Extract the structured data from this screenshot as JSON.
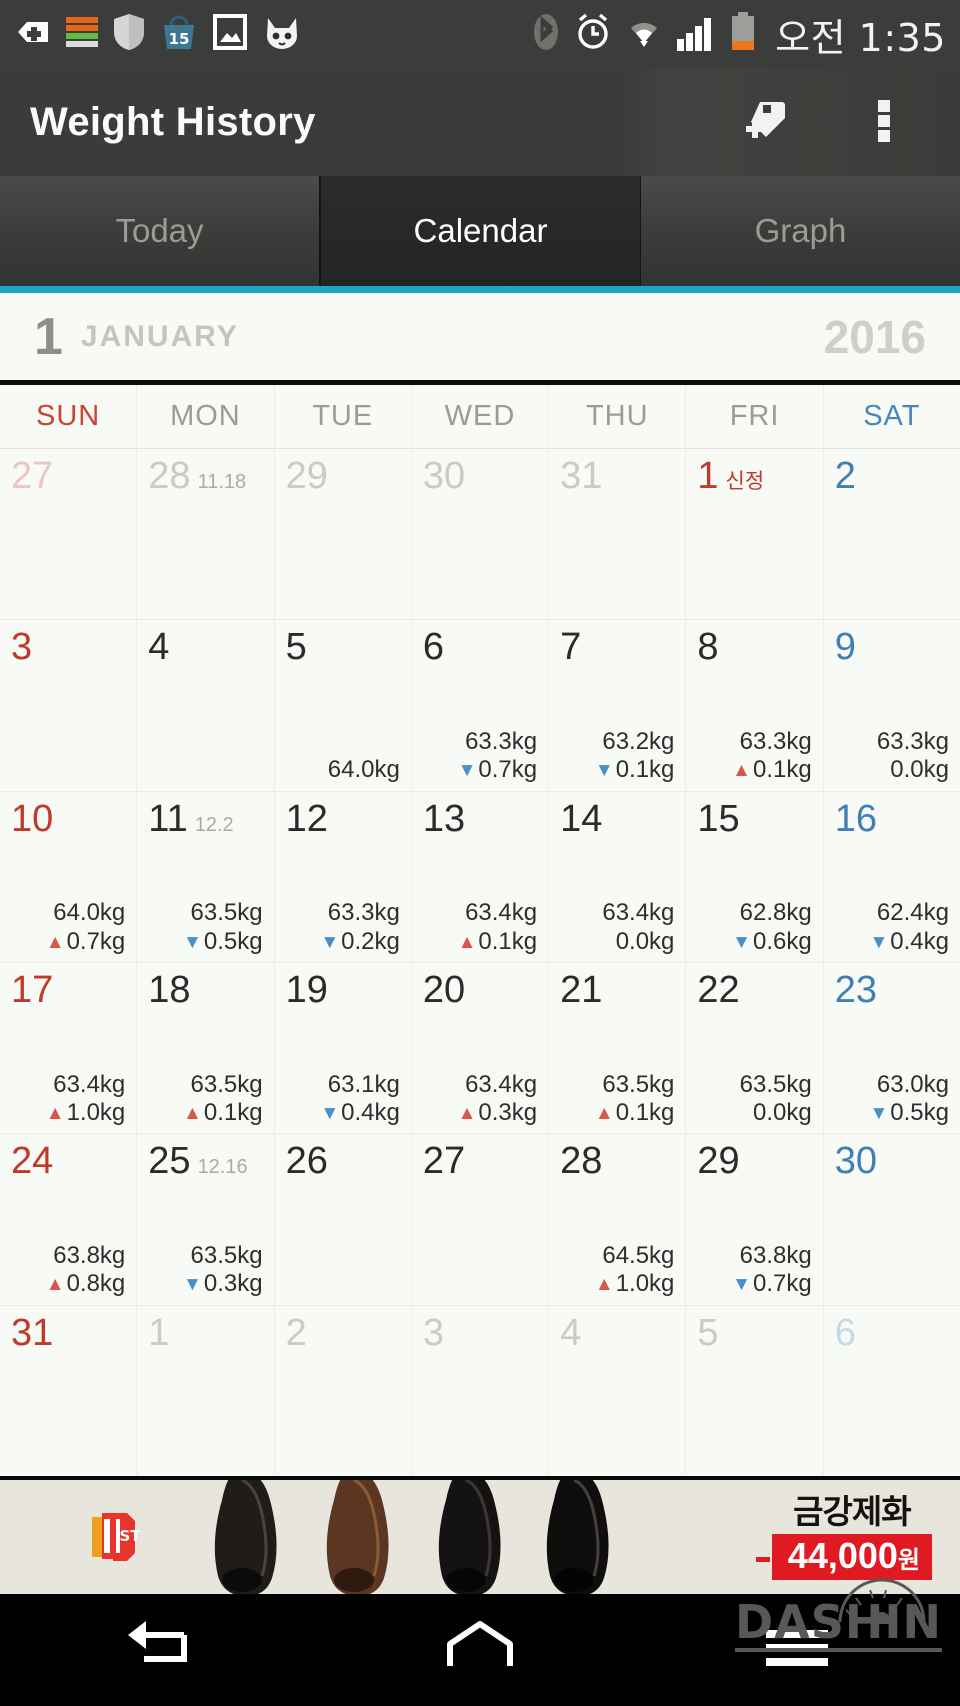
{
  "statusbar": {
    "time": "오전 1:35",
    "left_icons": [
      "medical-plus-icon",
      "storage-bars-icon",
      "shield-icon",
      "shopping-bag-15-icon",
      "gallery-image-icon",
      "cat-face-icon"
    ],
    "right_icons": [
      "bluetooth-icon",
      "alarm-clock-icon",
      "wifi-icon",
      "cellular-signal-icon",
      "battery-icon"
    ],
    "battery_color": "#f0761e"
  },
  "actionbar": {
    "title": "Weight History",
    "add_tag_label": "add-tag",
    "overflow_label": "more-options"
  },
  "tabs": {
    "items": [
      {
        "label": "Today",
        "active": false
      },
      {
        "label": "Calendar",
        "active": true
      },
      {
        "label": "Graph",
        "active": false
      }
    ],
    "accent_color": "#19a7c8"
  },
  "month_header": {
    "month_number": "1",
    "month_name": "JANUARY",
    "year": "2016"
  },
  "weekdays": [
    {
      "label": "SUN",
      "kind": "sun"
    },
    {
      "label": "MON",
      "kind": "week"
    },
    {
      "label": "TUE",
      "kind": "week"
    },
    {
      "label": "WED",
      "kind": "week"
    },
    {
      "label": "THU",
      "kind": "week"
    },
    {
      "label": "FRI",
      "kind": "week"
    },
    {
      "label": "SAT",
      "kind": "sat"
    }
  ],
  "calendar": {
    "unit": "kg",
    "up_color": "#d9574a",
    "down_color": "#4a90c8",
    "weeks": [
      [
        {
          "day": "27",
          "out": true,
          "kind": "sun"
        },
        {
          "day": "28",
          "out": true,
          "kind": "week",
          "lunar": "11.18"
        },
        {
          "day": "29",
          "out": true,
          "kind": "week"
        },
        {
          "day": "30",
          "out": true,
          "kind": "week"
        },
        {
          "day": "31",
          "out": true,
          "kind": "week"
        },
        {
          "day": "1",
          "out": false,
          "kind": "sun",
          "holiday": "신정"
        },
        {
          "day": "2",
          "out": false,
          "kind": "sat"
        }
      ],
      [
        {
          "day": "3",
          "out": false,
          "kind": "sun"
        },
        {
          "day": "4",
          "out": false,
          "kind": "week"
        },
        {
          "day": "5",
          "out": false,
          "kind": "week",
          "weight": "64.0kg"
        },
        {
          "day": "6",
          "out": false,
          "kind": "week",
          "weight": "63.3kg",
          "delta": "0.7kg",
          "dir": "down"
        },
        {
          "day": "7",
          "out": false,
          "kind": "week",
          "weight": "63.2kg",
          "delta": "0.1kg",
          "dir": "down"
        },
        {
          "day": "8",
          "out": false,
          "kind": "week",
          "weight": "63.3kg",
          "delta": "0.1kg",
          "dir": "up"
        },
        {
          "day": "9",
          "out": false,
          "kind": "sat",
          "weight": "63.3kg",
          "delta": "0.0kg",
          "dir": "flat"
        }
      ],
      [
        {
          "day": "10",
          "out": false,
          "kind": "sun",
          "weight": "64.0kg",
          "delta": "0.7kg",
          "dir": "up"
        },
        {
          "day": "11",
          "out": false,
          "kind": "week",
          "lunar": "12.2",
          "weight": "63.5kg",
          "delta": "0.5kg",
          "dir": "down"
        },
        {
          "day": "12",
          "out": false,
          "kind": "week",
          "weight": "63.3kg",
          "delta": "0.2kg",
          "dir": "down"
        },
        {
          "day": "13",
          "out": false,
          "kind": "week",
          "weight": "63.4kg",
          "delta": "0.1kg",
          "dir": "up"
        },
        {
          "day": "14",
          "out": false,
          "kind": "week",
          "weight": "63.4kg",
          "delta": "0.0kg",
          "dir": "flat"
        },
        {
          "day": "15",
          "out": false,
          "kind": "week",
          "weight": "62.8kg",
          "delta": "0.6kg",
          "dir": "down"
        },
        {
          "day": "16",
          "out": false,
          "kind": "sat",
          "weight": "62.4kg",
          "delta": "0.4kg",
          "dir": "down"
        }
      ],
      [
        {
          "day": "17",
          "out": false,
          "kind": "sun",
          "weight": "63.4kg",
          "delta": "1.0kg",
          "dir": "up"
        },
        {
          "day": "18",
          "out": false,
          "kind": "week",
          "weight": "63.5kg",
          "delta": "0.1kg",
          "dir": "up"
        },
        {
          "day": "19",
          "out": false,
          "kind": "week",
          "weight": "63.1kg",
          "delta": "0.4kg",
          "dir": "down"
        },
        {
          "day": "20",
          "out": false,
          "kind": "week",
          "weight": "63.4kg",
          "delta": "0.3kg",
          "dir": "up"
        },
        {
          "day": "21",
          "out": false,
          "kind": "week",
          "weight": "63.5kg",
          "delta": "0.1kg",
          "dir": "up"
        },
        {
          "day": "22",
          "out": false,
          "kind": "week",
          "weight": "63.5kg",
          "delta": "0.0kg",
          "dir": "flat"
        },
        {
          "day": "23",
          "out": false,
          "kind": "sat",
          "weight": "63.0kg",
          "delta": "0.5kg",
          "dir": "down"
        }
      ],
      [
        {
          "day": "24",
          "out": false,
          "kind": "sun",
          "weight": "63.8kg",
          "delta": "0.8kg",
          "dir": "up"
        },
        {
          "day": "25",
          "out": false,
          "kind": "week",
          "lunar": "12.16",
          "weight": "63.5kg",
          "delta": "0.3kg",
          "dir": "down"
        },
        {
          "day": "26",
          "out": false,
          "kind": "week"
        },
        {
          "day": "27",
          "out": false,
          "kind": "week"
        },
        {
          "day": "28",
          "out": false,
          "kind": "week",
          "weight": "64.5kg",
          "delta": "1.0kg",
          "dir": "up"
        },
        {
          "day": "29",
          "out": false,
          "kind": "week",
          "weight": "63.8kg",
          "delta": "0.7kg",
          "dir": "down"
        },
        {
          "day": "30",
          "out": false,
          "kind": "sat"
        }
      ],
      [
        {
          "day": "31",
          "out": false,
          "kind": "sun"
        },
        {
          "day": "1",
          "out": true,
          "kind": "week"
        },
        {
          "day": "2",
          "out": true,
          "kind": "week"
        },
        {
          "day": "3",
          "out": true,
          "kind": "week"
        },
        {
          "day": "4",
          "out": true,
          "kind": "week"
        },
        {
          "day": "5",
          "out": true,
          "kind": "week"
        },
        {
          "day": "6",
          "out": true,
          "kind": "sat"
        }
      ]
    ]
  },
  "ad": {
    "logo": "11ST",
    "brand": "금강제화",
    "price": "44,000",
    "currency": "원",
    "image": "dress-shoes-photo"
  },
  "navbar": {
    "back_label": "back",
    "home_label": "home",
    "recents_label": "recent-apps",
    "watermark": "DASHIN"
  }
}
